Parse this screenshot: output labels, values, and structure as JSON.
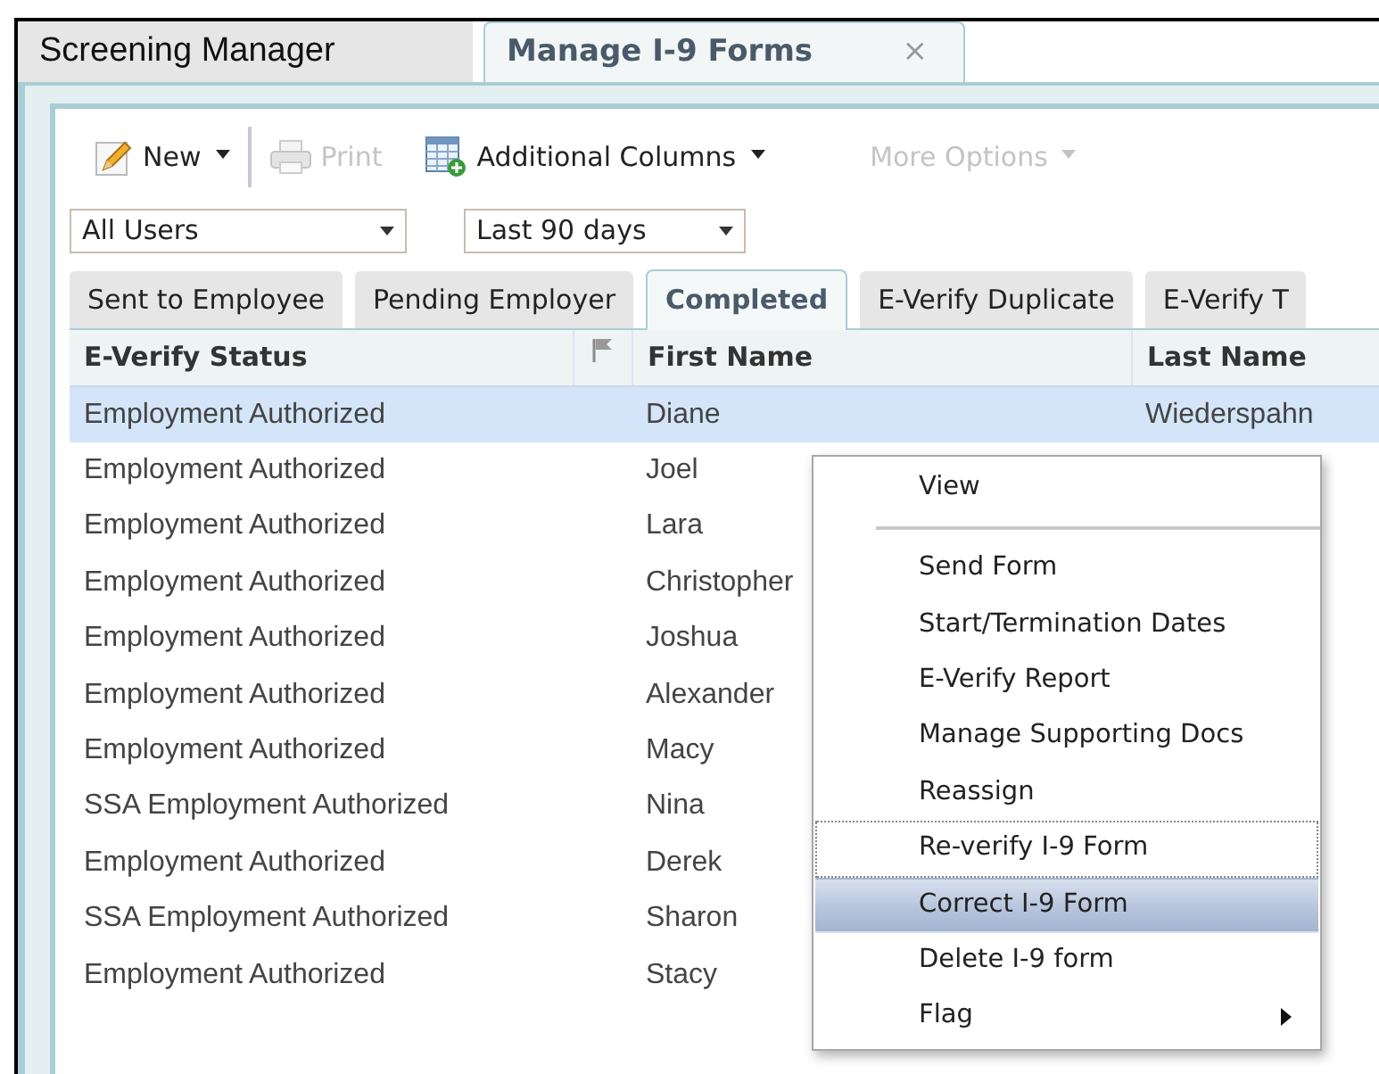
{
  "app_tabs": [
    {
      "label": "Screening Manager",
      "selected": false
    },
    {
      "label": "Manage I-9 Forms",
      "selected": true,
      "close": "×"
    }
  ],
  "toolbar": [
    {
      "kind": "new",
      "label": "New",
      "disabled": false,
      "dropdown": true
    },
    {
      "kind": "print",
      "label": "Print",
      "disabled": true,
      "dropdown": false
    },
    {
      "kind": "columns",
      "label": "Additional Columns",
      "disabled": false,
      "dropdown": true
    },
    {
      "kind": "more",
      "label": "More Options",
      "disabled": true,
      "dropdown": true
    }
  ],
  "filters": [
    {
      "value": "All Users"
    },
    {
      "value": "Last 90 days"
    }
  ],
  "status_tabs": [
    {
      "label": "Sent to Employee",
      "selected": false
    },
    {
      "label": "Pending Employer",
      "selected": false
    },
    {
      "label": "Completed",
      "selected": true
    },
    {
      "label": "E-Verify Duplicate",
      "selected": false
    },
    {
      "label": "E-Verify T",
      "selected": false
    }
  ],
  "table": {
    "columns": [
      {
        "kind": "text",
        "label": "E-Verify Status"
      },
      {
        "kind": "flag"
      },
      {
        "kind": "text",
        "label": "First Name"
      },
      {
        "kind": "text",
        "label": "Last Name"
      }
    ],
    "rows": [
      {
        "status": "Employment Authorized",
        "first_name": "Diane",
        "last_name": "Wiederspahn",
        "selected": true
      },
      {
        "status": "Employment Authorized",
        "first_name": "Joel",
        "selected": false
      },
      {
        "status": "Employment Authorized",
        "first_name": "Lara",
        "selected": false
      },
      {
        "status": "Employment Authorized",
        "first_name": "Christopher",
        "selected": false
      },
      {
        "status": "Employment Authorized",
        "first_name": "Joshua",
        "selected": false
      },
      {
        "status": "Employment Authorized",
        "first_name": "Alexander",
        "selected": false
      },
      {
        "status": "Employment Authorized",
        "first_name": "Macy",
        "selected": false
      },
      {
        "status": "SSA Employment Authorized",
        "first_name": "Nina",
        "selected": false
      },
      {
        "status": "Employment Authorized",
        "first_name": "Derek",
        "selected": false
      },
      {
        "status": "SSA Employment Authorized",
        "first_name": "Sharon",
        "selected": false
      },
      {
        "status": "Employment Authorized",
        "first_name": "Stacy",
        "selected": false
      }
    ]
  },
  "context_menu": {
    "items": [
      {
        "kind": "item",
        "label": "View",
        "focused": false,
        "selected": false,
        "submenu": false
      },
      {
        "kind": "separator"
      },
      {
        "kind": "item",
        "label": "Send Form",
        "focused": false,
        "selected": false,
        "submenu": false
      },
      {
        "kind": "item",
        "label": "Start/Termination Dates",
        "focused": false,
        "selected": false,
        "submenu": false
      },
      {
        "kind": "item",
        "label": "E-Verify Report",
        "focused": false,
        "selected": false,
        "submenu": false
      },
      {
        "kind": "item",
        "label": "Manage Supporting Docs",
        "focused": false,
        "selected": false,
        "submenu": false
      },
      {
        "kind": "item",
        "label": "Reassign",
        "focused": false,
        "selected": false,
        "submenu": false
      },
      {
        "kind": "item",
        "label": "Re-verify I-9 Form",
        "focused": true,
        "selected": false,
        "submenu": false
      },
      {
        "kind": "item",
        "label": "Correct I-9 Form",
        "focused": false,
        "selected": true,
        "submenu": false
      },
      {
        "kind": "item",
        "label": "Delete I-9 form",
        "focused": false,
        "selected": false,
        "submenu": false
      },
      {
        "kind": "item",
        "label": "Flag",
        "focused": false,
        "selected": false,
        "submenu": true
      }
    ]
  }
}
